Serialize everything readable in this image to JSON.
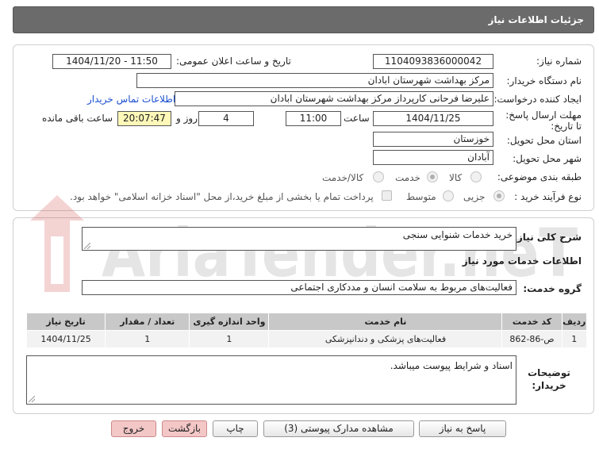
{
  "header": {
    "title": "جزئیات اطلاعات نیاز"
  },
  "fields": {
    "need_number_label": "شماره نیاز:",
    "need_number": "1104093836000042",
    "announce_label": "تاریخ و ساعت اعلان عمومی:",
    "announce_value": "1404/11/20 - 11:50",
    "buyer_org_label": "نام دستگاه خریدار:",
    "buyer_org": "مرکز بهداشت شهرستان ابادان",
    "creator_label": "ایجاد کننده درخواست:",
    "creator": "علیرضا فرحانی کارپرداز مرکز بهداشت شهرستان ابادان",
    "contact_link": "اطلاعات تماس خریدار",
    "deadline_label": "مهلت ارسال پاسخ: تا تاریخ:",
    "deadline_date": "1404/11/25",
    "time_label": "ساعت",
    "deadline_time": "11:00",
    "days_value": "4",
    "days_label": "روز و",
    "remaining_time": "20:07:47",
    "remaining_label": "ساعت باقی مانده",
    "province_label": "استان محل تحویل:",
    "province": "خوزستان",
    "city_label": "شهر محل تحویل:",
    "city": "آبادان",
    "category_label": "طبقه بندی موضوعی:",
    "category_options": [
      "کالا",
      "خدمت",
      "کالا/خدمت"
    ],
    "process_label": "نوع فرآیند خرید :",
    "process_options": [
      "جزیی",
      "متوسط"
    ],
    "payment_note": "پرداخت تمام یا بخشی از مبلغ خرید،از محل \"اسناد خزانه اسلامی\" خواهد بود."
  },
  "summary": {
    "label": "شرح کلی نیاز:",
    "value": "خرید خدمات شنوایی سنجی"
  },
  "services": {
    "section_title": "اطلاعات خدمات مورد نیاز",
    "group_label": "گروه خدمت:",
    "group_value": "فعالیت‌های مربوط به سلامت انسان و مددکاری اجتماعی",
    "columns": [
      "ردیف",
      "کد خدمت",
      "نام خدمت",
      "واحد اندازه گیری",
      "تعداد / مقدار",
      "تاریخ نیاز"
    ],
    "rows": [
      [
        "1",
        "ص-86-862",
        "فعالیت‌های پزشکی و دندانپزشکی",
        "1",
        "1",
        "1404/11/25"
      ]
    ]
  },
  "buyer_notes": {
    "label": "توضیحات خریدار:",
    "value": "اسناد و شرایط پیوست میباشد."
  },
  "watermark": {
    "text": "AriaTender.neT"
  },
  "buttons": {
    "reply": "پاسخ به نیاز",
    "attachments": "مشاهده مدارک پیوستی (3)",
    "print": "چاپ",
    "back": "بازگشت",
    "exit": "خروج"
  }
}
